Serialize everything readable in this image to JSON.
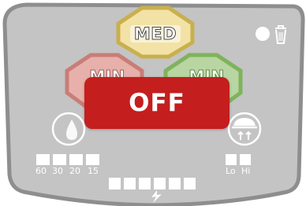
{
  "speeds": {
    "high_label": "MED",
    "low_label": "MIN",
    "right_label": "MIN"
  },
  "status": {
    "off_label": "OFF"
  },
  "timer": {
    "options": [
      "60",
      "30",
      "20",
      "15"
    ]
  },
  "fan": {
    "low_label": "Lo",
    "high_label": "Hi"
  },
  "colors": {
    "panel": "#c4c4c4",
    "panel_border": "#8e8e8e",
    "med_fill": "#f3e2a6",
    "med_border": "#c9b04e",
    "min_left_fill": "#e7b0ab",
    "min_left_border": "#c87e77",
    "min_right_fill": "#b8d5a2",
    "min_right_border": "#7fb35c",
    "off_button": "#c41e1e"
  },
  "icons": [
    "power-led-icon",
    "trash-icon",
    "humidity-drop-icon",
    "fan-heat-icon",
    "lightning-icon"
  ]
}
